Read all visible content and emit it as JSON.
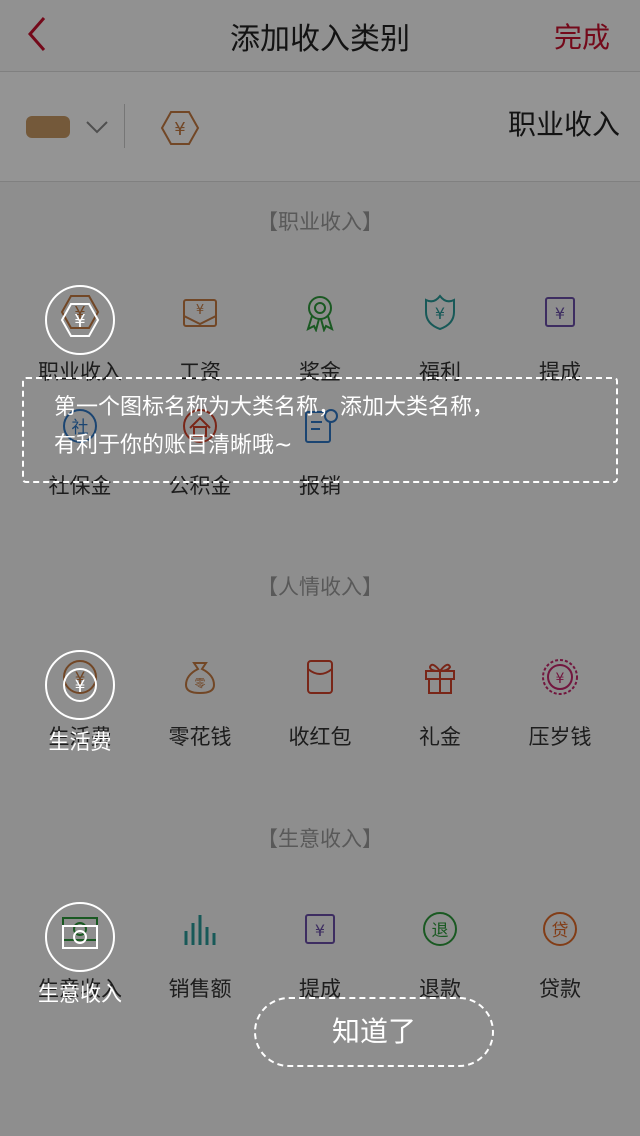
{
  "nav": {
    "title": "添加收入类别",
    "done_label": "完成"
  },
  "editor": {
    "category_name": "职业收入"
  },
  "colors": {
    "accent": "#c8102e",
    "swatch": "#c99a64",
    "job": "#c47a42",
    "green": "#2e9a3c",
    "teal": "#2a9a98",
    "purple": "#6a4fa8",
    "blue": "#2f78c4",
    "red": "#d0422a",
    "pink": "#c4276c",
    "orange": "#e06a28"
  },
  "sections": [
    {
      "title": "【职业收入】",
      "items": [
        {
          "label": "职业收入",
          "icon": "yen-hexagon-icon"
        },
        {
          "label": "工资",
          "icon": "salary-envelope-icon"
        },
        {
          "label": "奖金",
          "icon": "medal-icon"
        },
        {
          "label": "福利",
          "icon": "yen-shield-icon"
        },
        {
          "label": "提成",
          "icon": "yen-square-icon"
        },
        {
          "label": "社保金",
          "icon": "social-security-icon"
        },
        {
          "label": "公积金",
          "icon": "housing-fund-icon"
        },
        {
          "label": "报销",
          "icon": "reimburse-doc-icon"
        }
      ]
    },
    {
      "title": "【人情收入】",
      "items": [
        {
          "label": "生活费",
          "icon": "yen-circle-icon"
        },
        {
          "label": "零花钱",
          "icon": "money-bag-icon"
        },
        {
          "label": "收红包",
          "icon": "red-envelope-icon"
        },
        {
          "label": "礼金",
          "icon": "gift-icon"
        },
        {
          "label": "压岁钱",
          "icon": "yen-badge-icon"
        }
      ]
    },
    {
      "title": "【生意收入】",
      "items": [
        {
          "label": "生意收入",
          "icon": "banknote-icon"
        },
        {
          "label": "销售额",
          "icon": "bar-chart-icon"
        },
        {
          "label": "提成",
          "icon": "yen-square-icon"
        },
        {
          "label": "退款",
          "icon": "refund-circle-icon"
        },
        {
          "label": "贷款",
          "icon": "loan-circle-icon"
        }
      ]
    }
  ],
  "guide": {
    "tip_line1": "第一个图标名称为大类名称，添加大类名称，",
    "tip_line2": "有利于你的账目清晰哦~",
    "confirm_label": "知道了"
  }
}
